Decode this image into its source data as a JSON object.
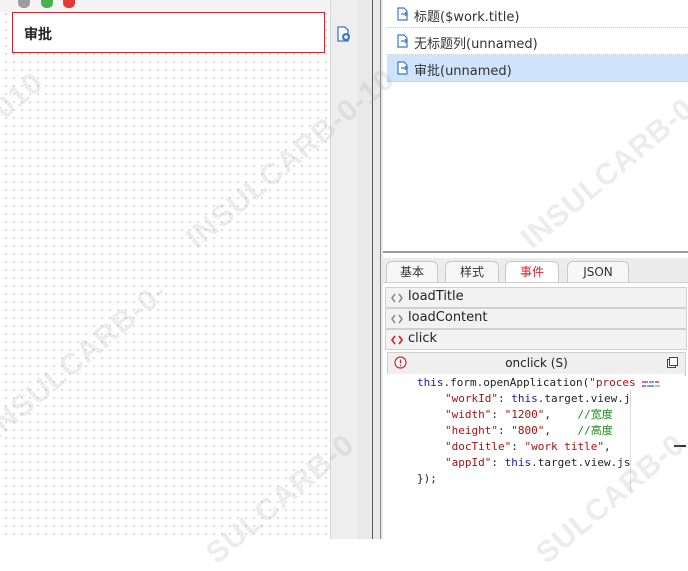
{
  "canvas": {
    "field_label": "审批"
  },
  "items_list": [
    {
      "label": "标题($work.title)",
      "selected": false
    },
    {
      "label": "无标题列(unnamed)",
      "selected": false
    },
    {
      "label": "审批(unnamed)",
      "selected": true
    }
  ],
  "tabs": [
    {
      "label": "基本",
      "active": false
    },
    {
      "label": "样式",
      "active": false
    },
    {
      "label": "事件",
      "active": true
    },
    {
      "label": "JSON",
      "active": false
    }
  ],
  "events": [
    {
      "label": "loadTitle",
      "active": false
    },
    {
      "label": "loadContent",
      "active": false
    },
    {
      "label": "click",
      "active": true
    }
  ],
  "editor": {
    "title": "onclick (S)"
  },
  "code_lines": [
    {
      "t1": "this",
      "t2": ".form.openApplication(",
      "t3": "\"proces",
      "t4": "",
      "indent": 0
    },
    {
      "t1": "\"workId\"",
      "t2": ": ",
      "t3": "this",
      "t4": ".target.view.js",
      "indent": 1
    },
    {
      "t1": "\"width\"",
      "t2": ": ",
      "t3": "\"1200\"",
      "t4": ",    ",
      "cmt": "//宽度",
      "indent": 1
    },
    {
      "t1": "\"height\"",
      "t2": ": ",
      "t3": "\"800\"",
      "t4": ",    ",
      "cmt": "//高度",
      "indent": 1
    },
    {
      "t1": "\"docTitle\"",
      "t2": ": ",
      "t3": "\"work title\"",
      "t4": ",",
      "indent": 1
    },
    {
      "t1": "\"appId\"",
      "t2": ": ",
      "t3": "this",
      "t4": ".target.view.jso",
      "indent": 1
    },
    {
      "t1": "});",
      "t2": "",
      "t3": "",
      "t4": "",
      "indent": 0
    }
  ],
  "watermark": "INSULCARB-0-10",
  "watermark_fragments": [
    "010",
    "INSULCARB-0-",
    "INSULCARB-0-10",
    "SULCARB-0",
    "INSULCARB-0-"
  ],
  "colors": {
    "accent_red": "#d7262b",
    "selection": "#cfe3fb",
    "keyword": "#1a1aa6",
    "string": "#a11111",
    "comment": "#1a8a1a"
  }
}
